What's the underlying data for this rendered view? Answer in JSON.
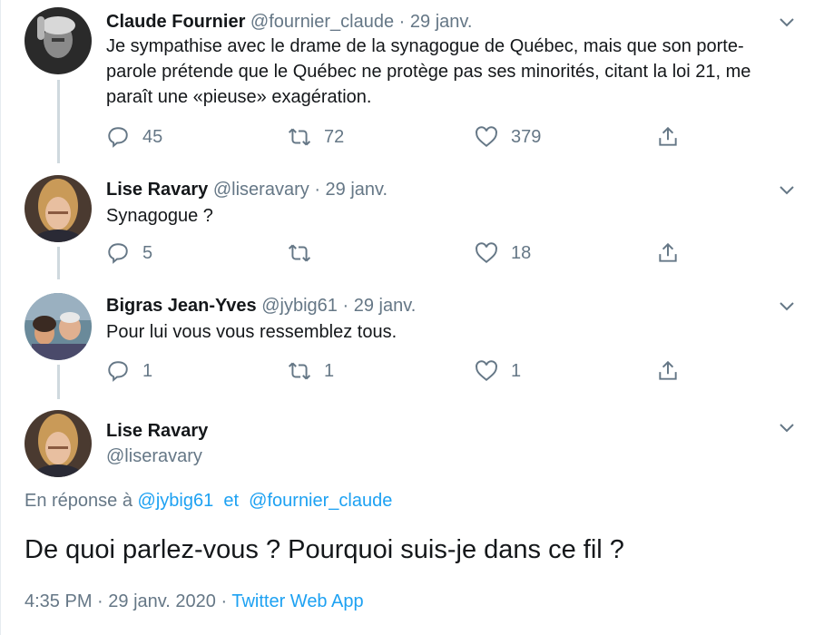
{
  "tweets": [
    {
      "name": "Claude Fournier",
      "handle": "@fournier_claude",
      "sep": "·",
      "date": "29 janv.",
      "text": "Je sympathise avec le drame de la synagogue de Québec, mais que son porte-parole prétende que le Québec ne protège pas ses minorités, citant la loi 21,  me paraît une «pieuse» exagération.",
      "replies": "45",
      "retweets": "72",
      "likes": "379"
    },
    {
      "name": "Lise Ravary",
      "handle": "@liseravary",
      "sep": "·",
      "date": "29 janv.",
      "text": "Synagogue ?",
      "replies": "5",
      "retweets": "",
      "likes": "18"
    },
    {
      "name": "Bigras Jean-Yves",
      "handle": "@jybig61",
      "sep": "·",
      "date": "29 janv.",
      "text": "Pour lui vous vous ressemblez tous.",
      "replies": "1",
      "retweets": "1",
      "likes": "1"
    }
  ],
  "main_tweet": {
    "name": "Lise Ravary",
    "handle": "@liseravary",
    "reply_prefix": "En réponse à",
    "reply_mention_1": "@jybig61",
    "reply_and": "et",
    "reply_mention_2": "@fournier_claude",
    "text": "De quoi parlez-vous ? Pourquoi suis-je dans ce fil ?",
    "time": "4:35 PM",
    "sep": "·",
    "date": "29 janv. 2020",
    "app": "Twitter Web App"
  },
  "icons": {
    "reply": "reply-icon",
    "retweet": "retweet-icon",
    "like": "heart-icon",
    "share": "share-icon",
    "menu": "chevron-down-icon"
  },
  "colors": {
    "link": "#1da1f2",
    "muted": "#657786",
    "text": "#14171a"
  }
}
